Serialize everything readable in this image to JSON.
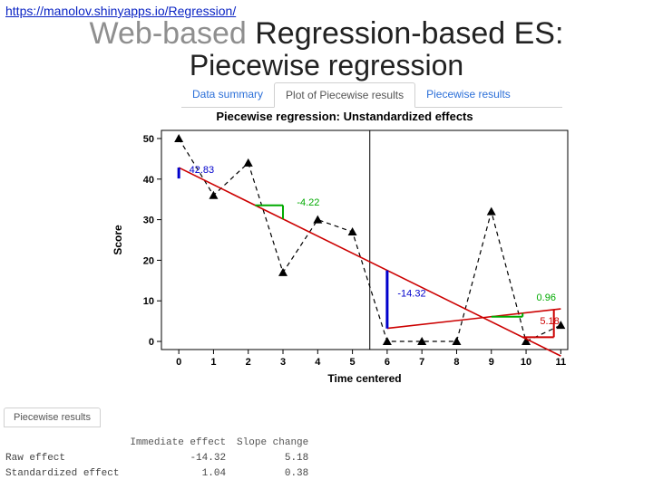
{
  "url": "https://manolov.shinyapps.io/Regression/",
  "heading": {
    "line1_grey": "Web-based ",
    "line1_black": "Regression-based ES:",
    "line2": "Piecewise regression"
  },
  "tabs": {
    "items": [
      {
        "label": "Data summary",
        "active": false
      },
      {
        "label": "Plot of Piecewise results",
        "active": true
      },
      {
        "label": "Piecewise results",
        "active": false
      }
    ]
  },
  "plot": {
    "title": "Piecewise regression: Unstandardized effects",
    "xlabel": "Time centered",
    "ylabel": "Score"
  },
  "chart_data": {
    "type": "scatter",
    "title": "Piecewise regression: Unstandardized effects",
    "xlabel": "Time centered",
    "ylabel": "Score",
    "xlim": [
      -0.5,
      11.2
    ],
    "ylim": [
      -2,
      52
    ],
    "xticks": [
      0,
      1,
      2,
      3,
      4,
      5,
      6,
      7,
      8,
      9,
      10,
      11
    ],
    "yticks": [
      0,
      10,
      20,
      30,
      40,
      50
    ],
    "phase_break_x": 5.5,
    "series": [
      {
        "name": "observed",
        "marker": "triangle",
        "line": "dashed",
        "x": [
          0,
          1,
          2,
          3,
          4,
          5,
          6,
          7,
          8,
          9,
          10,
          11
        ],
        "y": [
          50,
          36,
          44,
          17,
          30,
          27,
          0,
          0,
          0,
          32,
          0,
          4
        ]
      },
      {
        "name": "baseline_fit",
        "type": "line",
        "color": "red",
        "coef": {
          "intercept_at_x0": 42.83,
          "slope": -4.22
        },
        "extends_to_x": 11
      },
      {
        "name": "treatment_fit",
        "type": "line",
        "color": "red",
        "coef": {
          "intercept_at_x6": 3.22,
          "slope": 0.96
        },
        "from_x": 6,
        "to_x": 11
      }
    ],
    "annotations": [
      {
        "text": "42.83",
        "x": 0.3,
        "y": 41.5,
        "color": "blue"
      },
      {
        "text": "-4.22",
        "x": 3.4,
        "y": 33.5,
        "color": "green"
      },
      {
        "text": "-14.32",
        "x": 6.3,
        "y": 11,
        "color": "blue"
      },
      {
        "text": "0.96",
        "x": 10.3,
        "y": 10,
        "color": "green"
      },
      {
        "text": "5.18",
        "x": 10.4,
        "y": 4.2,
        "color": "red"
      }
    ],
    "drop_lines": [
      {
        "x": 6,
        "y_from": 17.5,
        "y_to": 3.2,
        "color": "blue",
        "label": "-14.32"
      }
    ]
  },
  "results": {
    "tab_label": "Piecewise results",
    "columns": [
      "",
      "Immediate effect",
      "Slope change"
    ],
    "rows": [
      {
        "label": "Raw effect",
        "immediate": "-14.32",
        "slope": "5.18"
      },
      {
        "label": "Standardized effect",
        "immediate": "1.04",
        "slope": "0.38"
      }
    ]
  }
}
